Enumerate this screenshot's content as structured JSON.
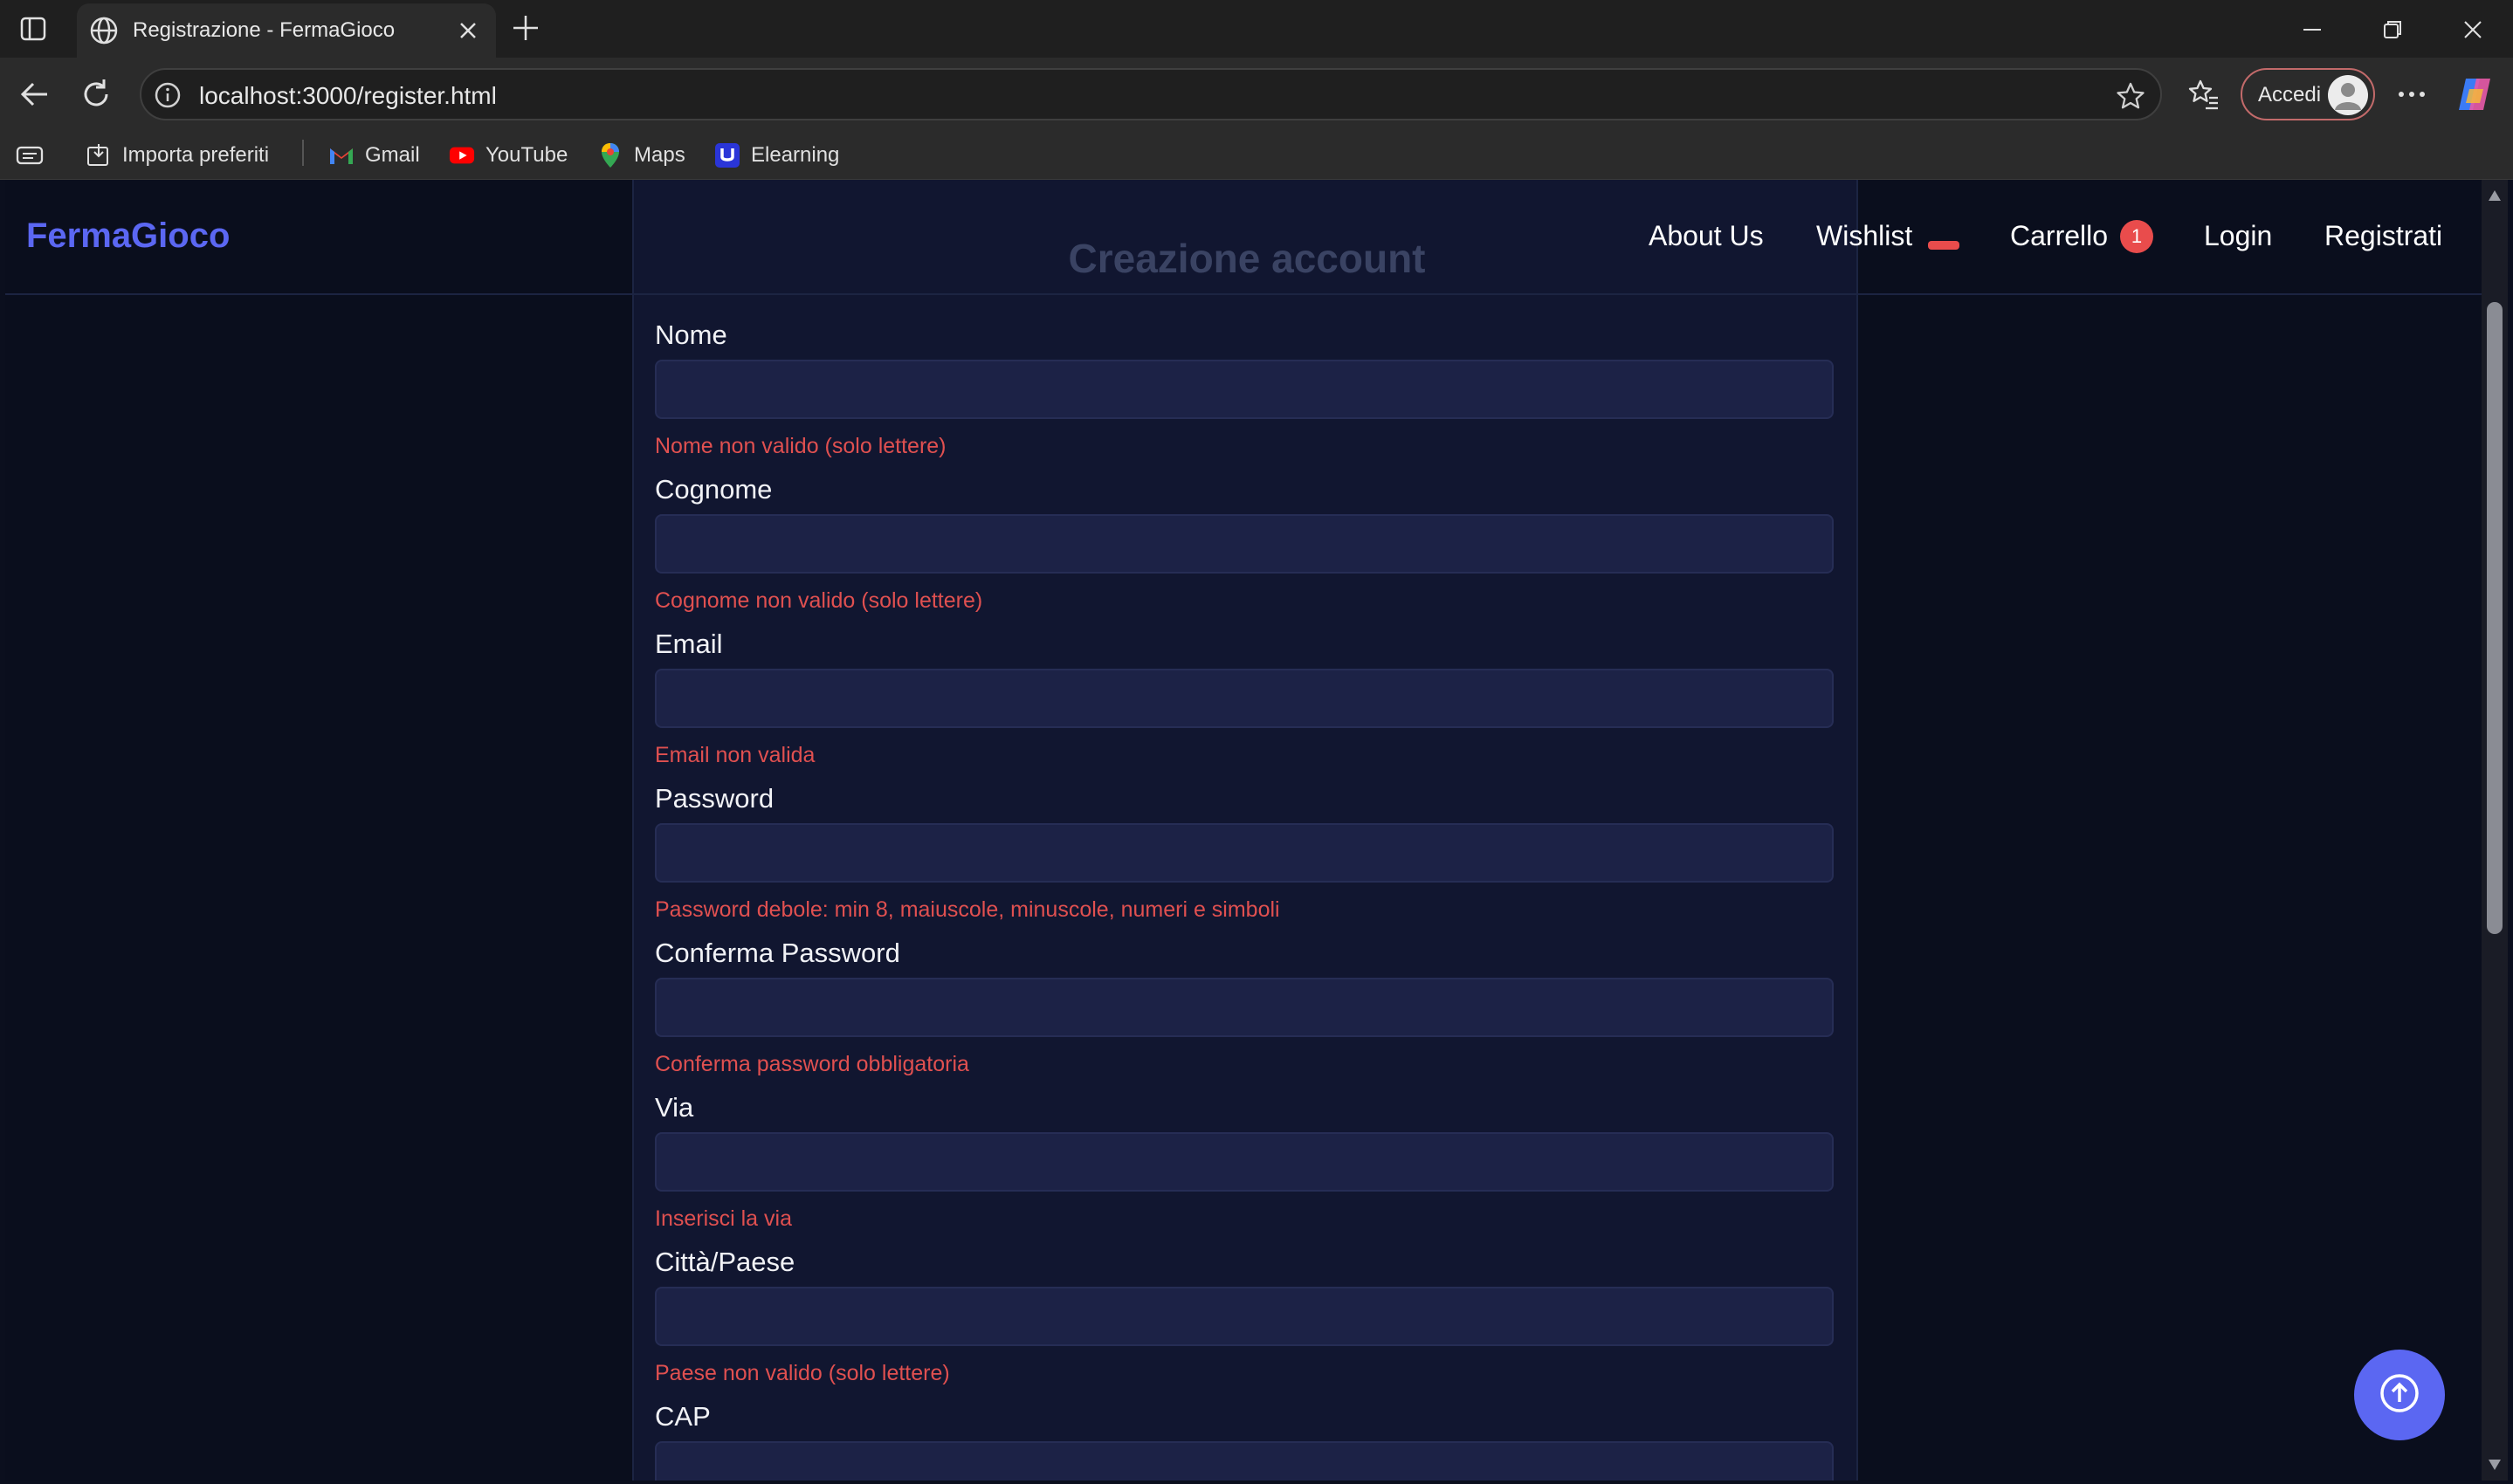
{
  "browser": {
    "tab_title": "Registrazione - FermaGioco",
    "url": "localhost:3000/register.html",
    "accedi_label": "Accedi",
    "bookmarks": [
      {
        "label": "Importa preferiti",
        "icon": "import-icon"
      },
      {
        "label": "Gmail",
        "icon": "gmail-icon"
      },
      {
        "label": "YouTube",
        "icon": "youtube-icon"
      },
      {
        "label": "Maps",
        "icon": "maps-icon"
      },
      {
        "label": "Elearning",
        "icon": "elearning-icon"
      }
    ]
  },
  "site": {
    "logo": "FermaGioco",
    "nav": {
      "about": "About Us",
      "wishlist": "Wishlist",
      "cart": "Carrello",
      "cart_count": "1",
      "login": "Login",
      "register": "Registrati"
    },
    "colors": {
      "accent": "#5b67f2",
      "error": "#e05050",
      "badge": "#e94c4c",
      "background": "#0a0e1d",
      "card": "#111630",
      "input": "#1c2246"
    }
  },
  "form": {
    "title": "Creazione account",
    "fields": [
      {
        "label": "Nome",
        "value": "",
        "error": "Nome non valido (solo lettere)"
      },
      {
        "label": "Cognome",
        "value": "",
        "error": "Cognome non valido (solo lettere)"
      },
      {
        "label": "Email",
        "value": "",
        "error": "Email non valida"
      },
      {
        "label": "Password",
        "value": "",
        "error": "Password debole: min 8, maiuscole, minuscole, numeri e simboli"
      },
      {
        "label": "Conferma Password",
        "value": "",
        "error": "Conferma password obbligatoria"
      },
      {
        "label": "Via",
        "value": "",
        "error": "Inserisci la via"
      },
      {
        "label": "Città/Paese",
        "value": "",
        "error": "Paese non valido (solo lettere)"
      },
      {
        "label": "CAP",
        "value": "",
        "error": ""
      }
    ]
  }
}
